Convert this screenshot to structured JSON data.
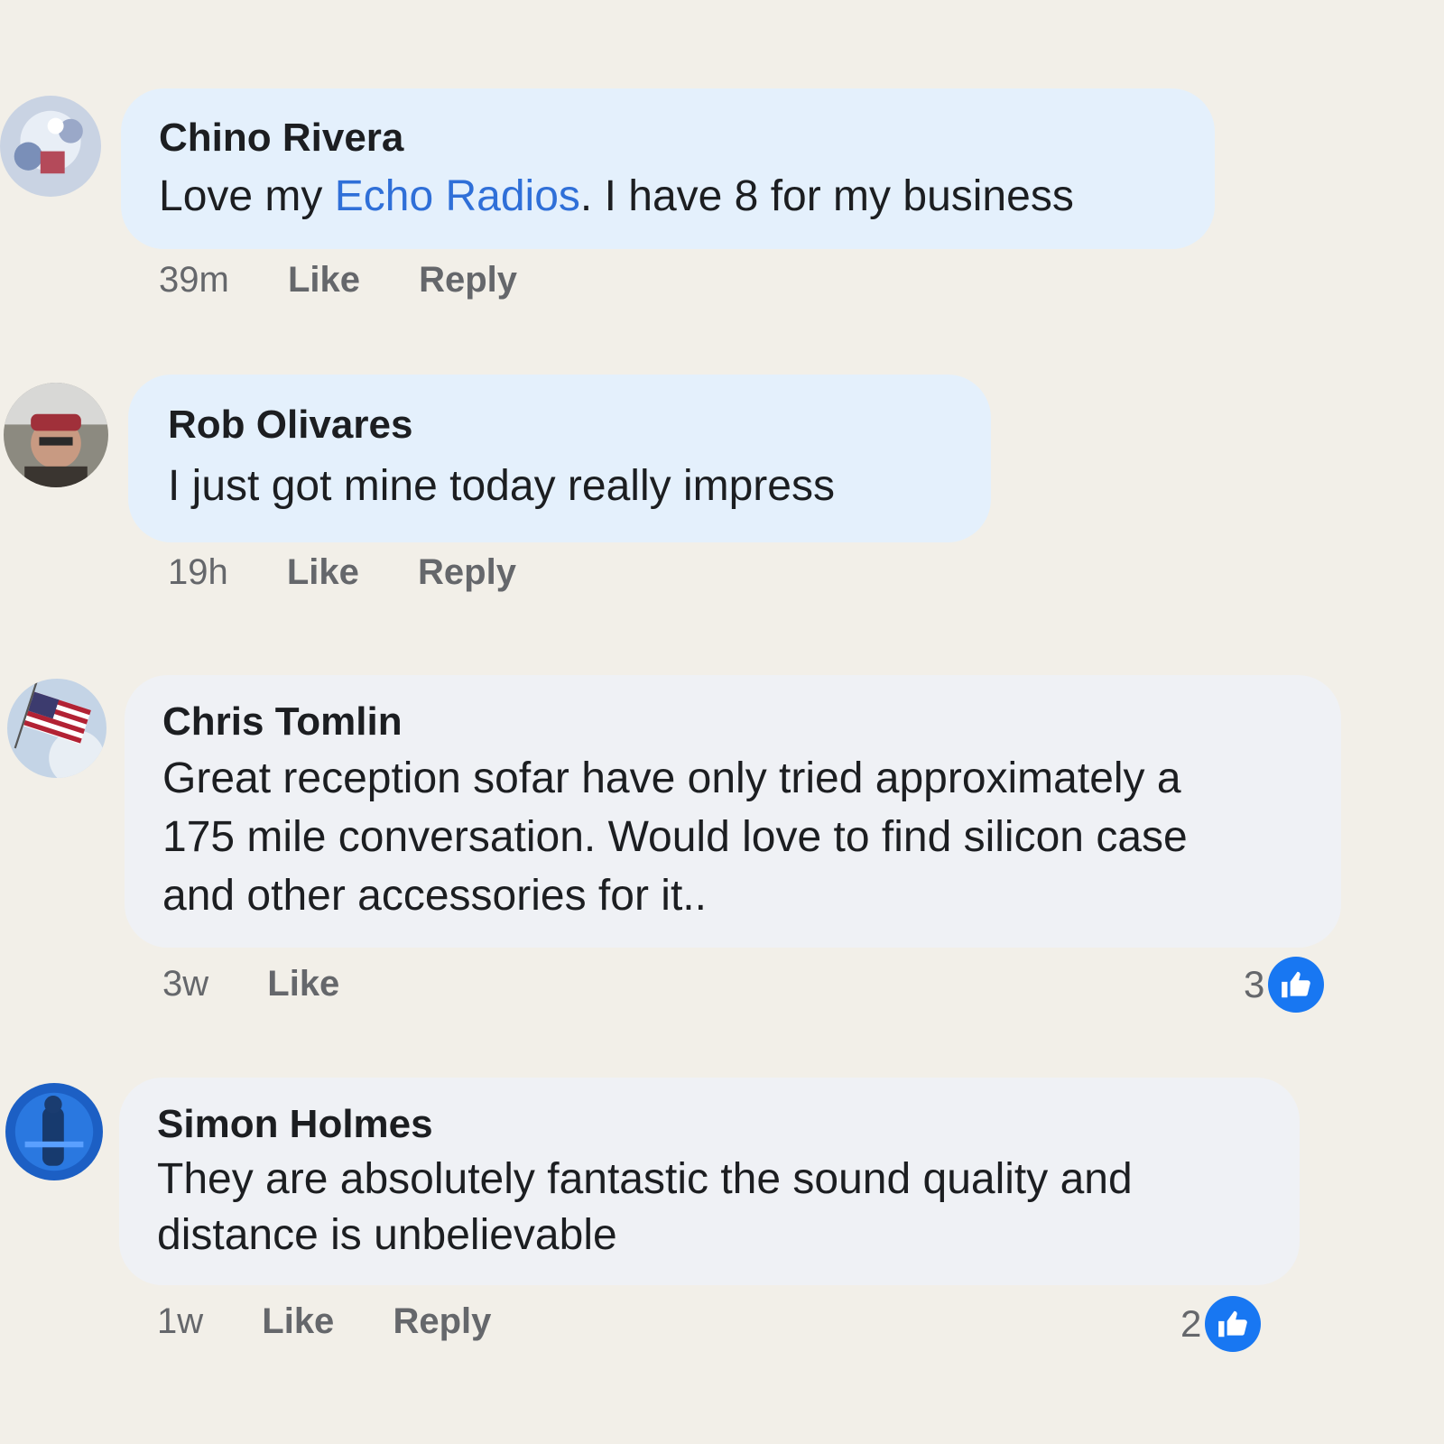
{
  "comments": [
    {
      "author": "Chino Rivera",
      "text_before": "Love my ",
      "mention": "Echo Radios",
      "text_after": ". I have 8 for my business",
      "time": "39m",
      "like_label": "Like",
      "reply_label": "Reply"
    },
    {
      "author": "Rob Olivares",
      "text": "I just got mine today really impress",
      "time": "19h",
      "like_label": "Like",
      "reply_label": "Reply"
    },
    {
      "author": "Chris Tomlin",
      "lines": [
        "Great reception sofar have only tried approximately a",
        "175 mile conversation. Would love to find silicon case",
        "and other accessories for it.."
      ],
      "time": "3w",
      "like_label": "Like",
      "reaction_count": "3"
    },
    {
      "author": "Simon Holmes",
      "lines": [
        "They are absolutely fantastic the sound quality and",
        "distance is unbelievable"
      ],
      "time": "1w",
      "like_label": "Like",
      "reply_label": "Reply",
      "reaction_count": "2"
    }
  ],
  "colors": {
    "background": "#f2efe8",
    "bubble_blue": "#e4f0fc",
    "bubble_grey": "#eff1f5",
    "mention": "#2f6fd8",
    "like_badge": "#1877f2"
  },
  "icons": [
    "avatar",
    "thumbs-up-icon"
  ]
}
